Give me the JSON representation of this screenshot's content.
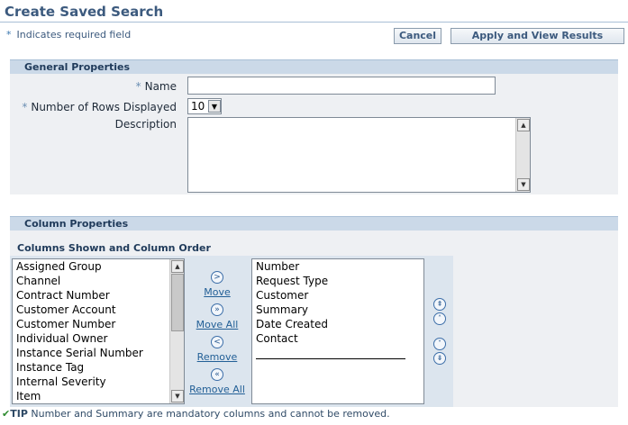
{
  "header": {
    "title": "Create Saved Search",
    "required_note": "Indicates required field",
    "required_star": "*",
    "cancel_label": "Cancel",
    "apply_label": "Apply and View Results"
  },
  "general": {
    "header": "General Properties",
    "name_label": "Name",
    "name_value": "",
    "rows_label": "Number of Rows Displayed",
    "rows_value": "10",
    "description_label": "Description",
    "description_value": ""
  },
  "columns": {
    "header": "Column Properties",
    "subheader": "Columns Shown and Column Order",
    "available": [
      "Assigned Group",
      "Channel",
      "Contract Number",
      "Customer Account",
      "Customer Number",
      "Individual Owner",
      "Instance Serial Number",
      "Instance Tag",
      "Internal Severity",
      "Item"
    ],
    "selected": [
      "Number",
      "Request Type",
      "Customer",
      "Summary",
      "Date Created",
      "Contact"
    ],
    "move_label": "Move",
    "move_all_label": "Move All",
    "remove_label": "Remove",
    "remove_all_label": "Remove All",
    "tip_label": "TIP",
    "tip_text": "Number and Summary are mandatory columns and cannot be removed."
  },
  "colors": {
    "title": "#3c5a7e",
    "header_band": "#cbd9e8",
    "panel": "#eef0f3",
    "link": "#225f96"
  },
  "icons": {
    "move": "chevron-right-circle-icon",
    "move_all": "double-chevron-right-circle-icon",
    "remove": "chevron-left-circle-icon",
    "remove_all": "double-chevron-left-circle-icon",
    "order": [
      "move-top-icon",
      "move-up-icon",
      "move-down-icon",
      "move-bottom-icon"
    ],
    "tip": "check-icon"
  }
}
